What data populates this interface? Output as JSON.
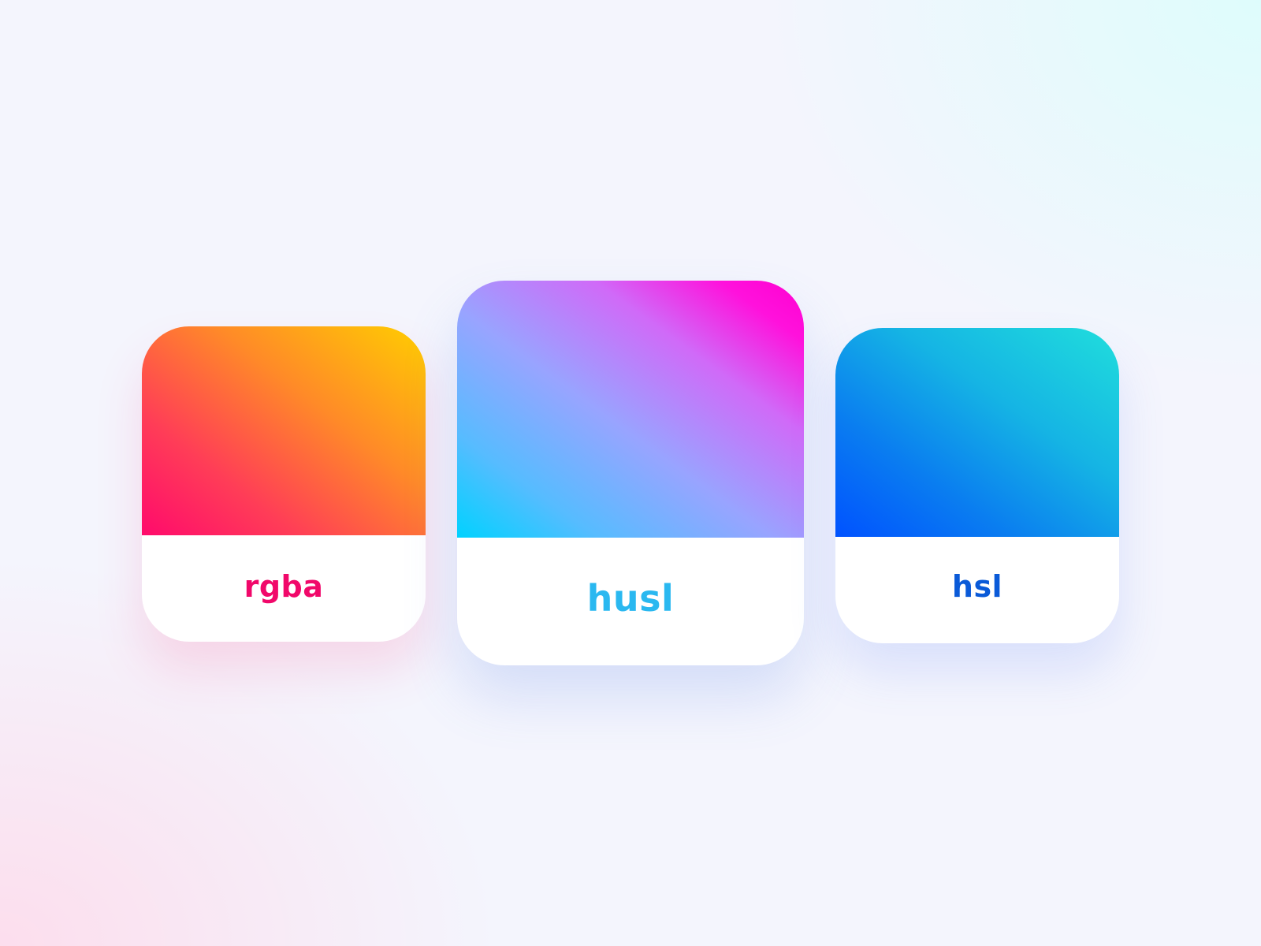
{
  "cards": [
    {
      "id": "rgba",
      "label": "rgba",
      "label_color": "#f1086a",
      "gradient_colors": [
        "#ff0a6c",
        "#ff8a28",
        "#ffce00"
      ]
    },
    {
      "id": "husl",
      "label": "husl",
      "label_color": "#2ab8f0",
      "gradient_colors": [
        "#00d2ff",
        "#98a4ff",
        "#ff00d0"
      ]
    },
    {
      "id": "hsl",
      "label": "hsl",
      "label_color": "#0a5ad8",
      "gradient_colors": [
        "#0052ff",
        "#15b4e4",
        "#20dedc"
      ]
    }
  ]
}
